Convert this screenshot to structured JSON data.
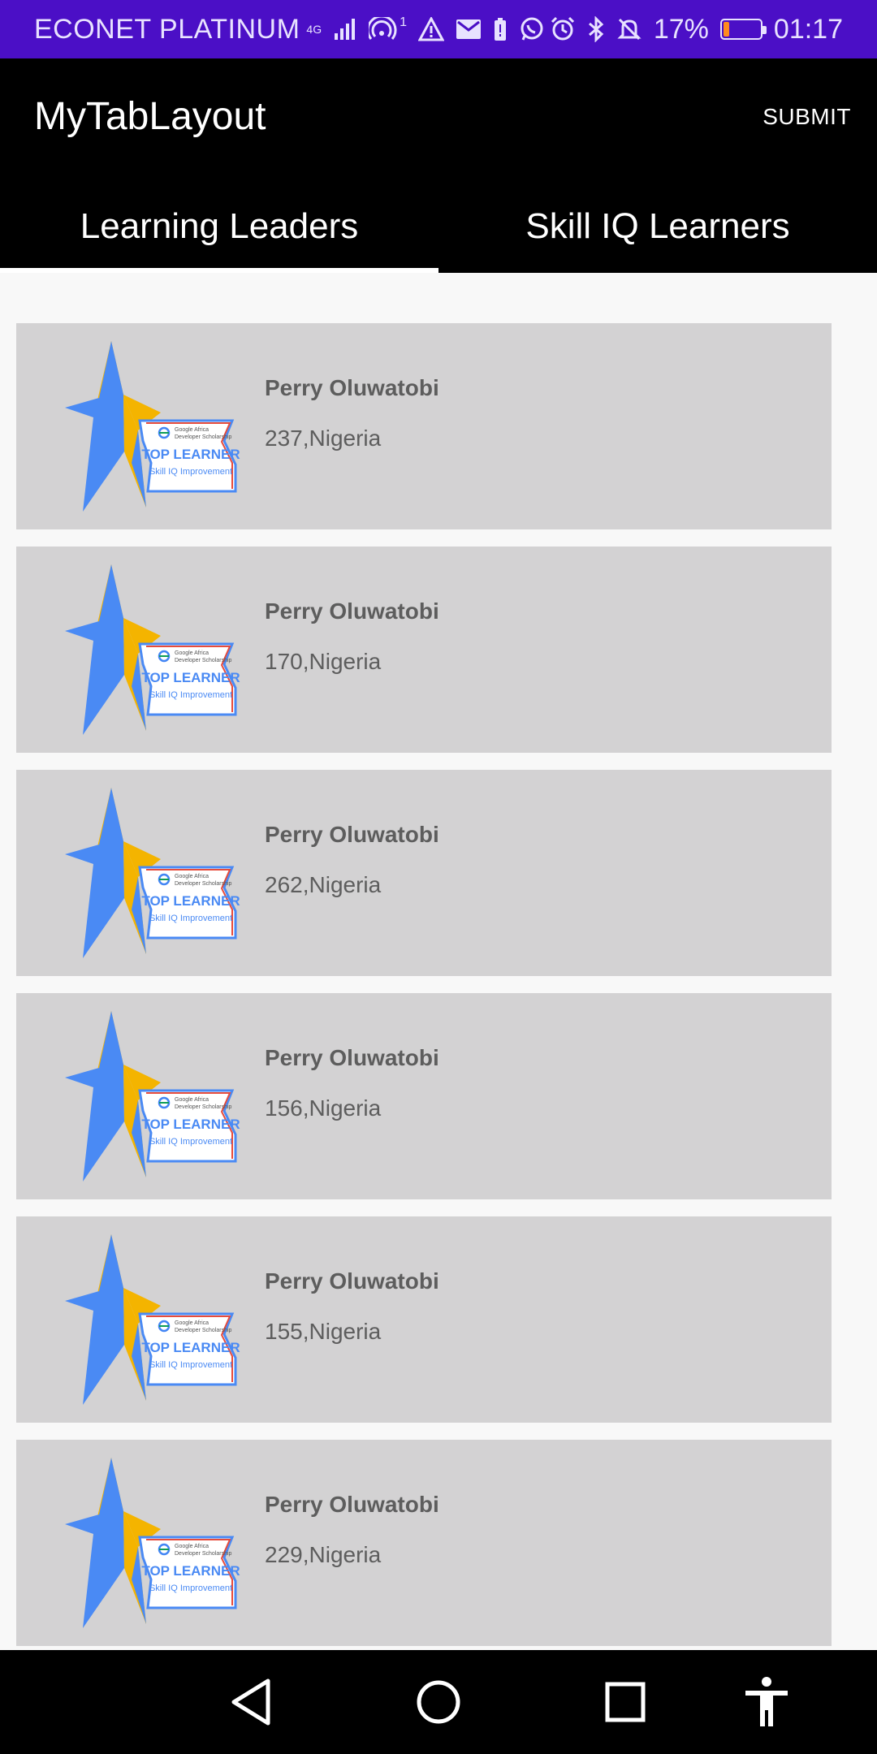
{
  "status_bar": {
    "carrier": "ECONET PLATINUM",
    "network": "4G",
    "hotspot_count": "1",
    "battery_percent": "17%",
    "battery_level": 0.17,
    "time": "01:17"
  },
  "app_bar": {
    "title": "MyTabLayout",
    "submit_label": "SUBMIT"
  },
  "tabs": [
    {
      "label": "Learning Leaders",
      "selected": true
    },
    {
      "label": "Skill IQ Learners",
      "selected": false
    }
  ],
  "badge": {
    "org_line1": "Google Africa",
    "org_line2": "Developer Scholarship",
    "title": "TOP LEARNER",
    "subtitle": "Skill IQ Improvement"
  },
  "learners": [
    {
      "name": "Perry Oluwatobi",
      "details": "237,Nigeria"
    },
    {
      "name": "Perry Oluwatobi",
      "details": "170,Nigeria"
    },
    {
      "name": "Perry Oluwatobi",
      "details": "262,Nigeria"
    },
    {
      "name": "Perry Oluwatobi",
      "details": "156,Nigeria"
    },
    {
      "name": "Perry Oluwatobi",
      "details": "155,Nigeria"
    },
    {
      "name": "Perry Oluwatobi",
      "details": "229,Nigeria"
    }
  ],
  "colors": {
    "status_bar": "#4b0fc6",
    "app_bar": "#000000",
    "card": "#d3d2d3",
    "badge_blue": "#4a8af4",
    "badge_yellow": "#f4b400"
  }
}
